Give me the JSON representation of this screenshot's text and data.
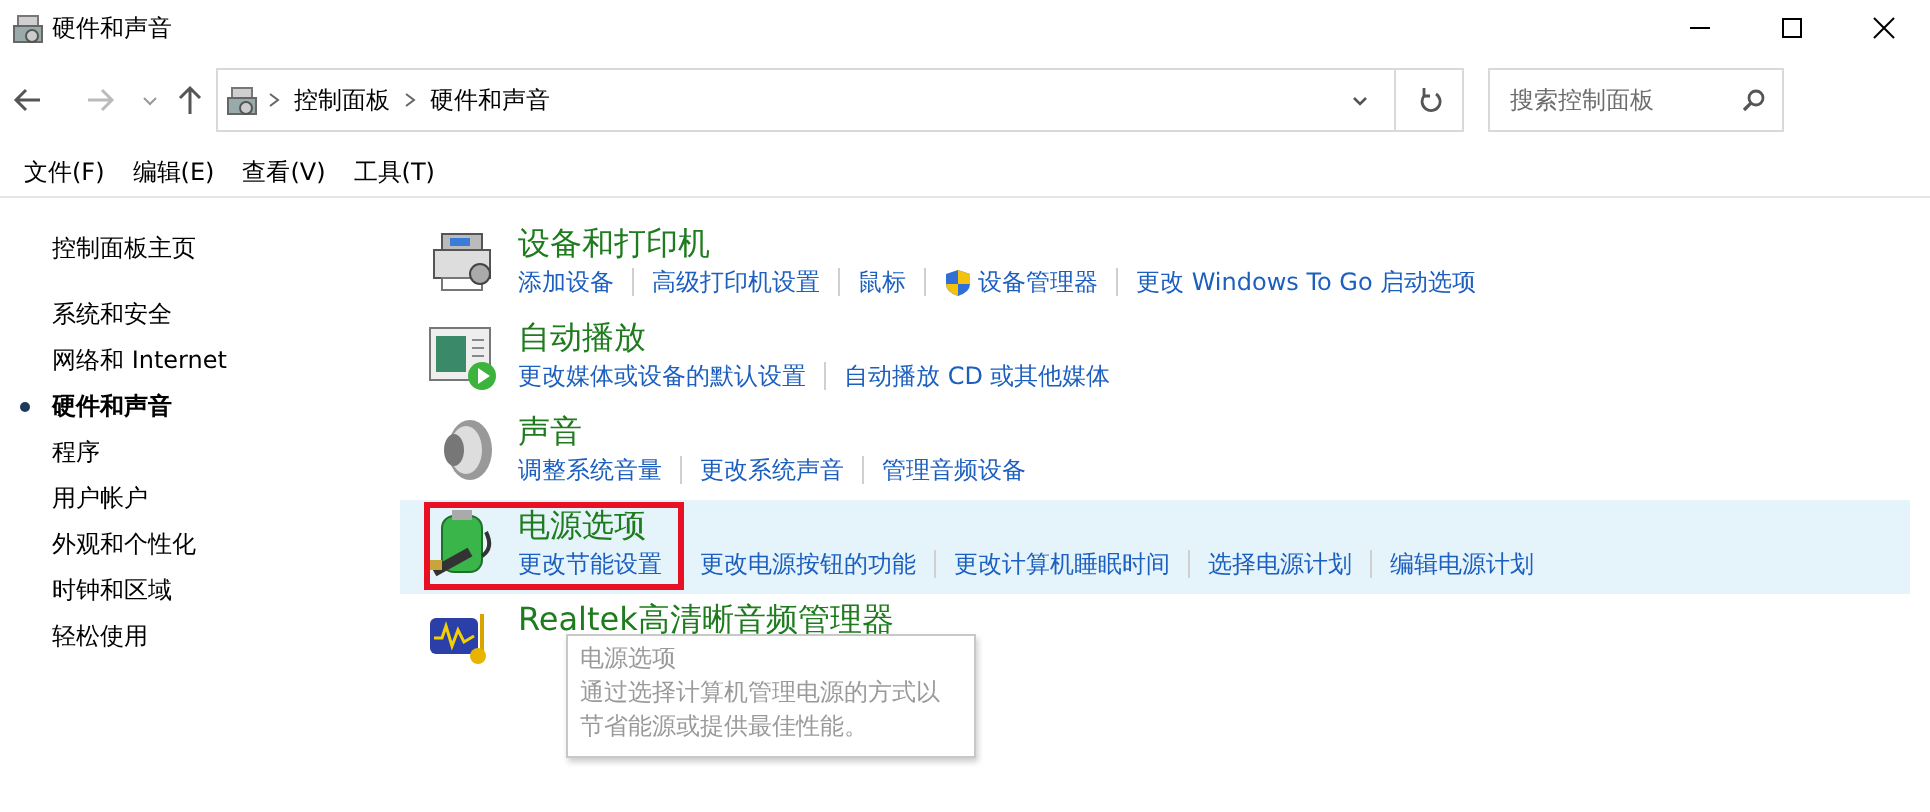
{
  "window": {
    "title": "硬件和声音"
  },
  "address": {
    "crumbs": [
      "控制面板",
      "硬件和声音"
    ]
  },
  "search": {
    "placeholder": "搜索控制面板"
  },
  "menu": [
    "文件(F)",
    "编辑(E)",
    "查看(V)",
    "工具(T)"
  ],
  "sidebar": {
    "home": "控制面板主页",
    "items": [
      {
        "label": "系统和安全",
        "selected": false
      },
      {
        "label": "网络和 Internet",
        "selected": false
      },
      {
        "label": "硬件和声音",
        "selected": true
      },
      {
        "label": "程序",
        "selected": false
      },
      {
        "label": "用户帐户",
        "selected": false
      },
      {
        "label": "外观和个性化",
        "selected": false
      },
      {
        "label": "时钟和区域",
        "selected": false
      },
      {
        "label": "轻松使用",
        "selected": false
      }
    ]
  },
  "categories": [
    {
      "kind": "printer",
      "title": "设备和打印机",
      "hovered": false,
      "links": [
        {
          "text": "添加设备",
          "kind": "plain"
        },
        {
          "text": "高级打印机设置",
          "kind": "plain"
        },
        {
          "text": "鼠标",
          "kind": "plain"
        },
        {
          "text": "设备管理器",
          "kind": "shield"
        },
        {
          "text": "更改 Windows To Go 启动选项",
          "kind": "plain"
        }
      ]
    },
    {
      "kind": "autoplay",
      "title": "自动播放",
      "hovered": false,
      "links": [
        {
          "text": "更改媒体或设备的默认设置",
          "kind": "plain"
        },
        {
          "text": "自动播放 CD 或其他媒体",
          "kind": "plain"
        }
      ]
    },
    {
      "kind": "speaker",
      "title": "声音",
      "hovered": false,
      "links": [
        {
          "text": "调整系统音量",
          "kind": "plain"
        },
        {
          "text": "更改系统声音",
          "kind": "plain"
        },
        {
          "text": "管理音频设备",
          "kind": "plain"
        }
      ]
    },
    {
      "kind": "battery",
      "title": "电源选项",
      "hovered": true,
      "links": [
        {
          "text": "更改节能设置",
          "kind": "plain"
        },
        {
          "text": "更改电源按钮的功能",
          "kind": "plain"
        },
        {
          "text": "更改计算机睡眠时间",
          "kind": "plain"
        },
        {
          "text": "选择电源计划",
          "kind": "plain"
        },
        {
          "text": "编辑电源计划",
          "kind": "plain"
        }
      ]
    },
    {
      "kind": "audio",
      "title": "Realtek高清晰音频管理器",
      "hovered": false
    }
  ],
  "tooltip": {
    "title": "电源选项",
    "text": "通过选择计算机管理电源的方式以节省能源或提供最佳性能。"
  }
}
